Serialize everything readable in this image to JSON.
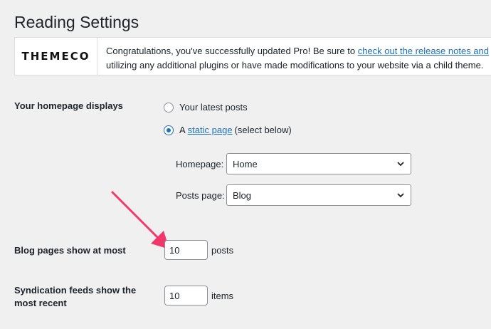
{
  "page": {
    "title": "Reading Settings"
  },
  "notice": {
    "logo": "THEMECO",
    "text_before": "Congratulations, you've successfully updated Pro! Be sure to ",
    "link": "check out the release notes and",
    "text_after": "utilizing any additional plugins or have made modifications to your website via a child theme."
  },
  "homepage": {
    "label": "Your homepage displays",
    "option_latest": "Your latest posts",
    "option_static_prefix": "A",
    "option_static_link": "static page",
    "option_static_suffix": "(select below)",
    "selected": "static page"
  },
  "selects": {
    "homepage_label": "Homepage:",
    "homepage_value": "Home",
    "posts_label": "Posts page:",
    "posts_value": "Blog"
  },
  "blog_pages": {
    "label": "Blog pages show at most",
    "value": "10",
    "unit": "posts"
  },
  "syndication": {
    "label_line1": "Syndication feeds show the",
    "label_line2": "most recent",
    "value": "10",
    "unit": "items"
  },
  "colors": {
    "accent": "#2271b1",
    "arrow": "#f0386b",
    "background": "#f0f0f1"
  },
  "icons": {
    "chevron": "chevron-down-icon",
    "arrow": "annotation-arrow-icon"
  }
}
